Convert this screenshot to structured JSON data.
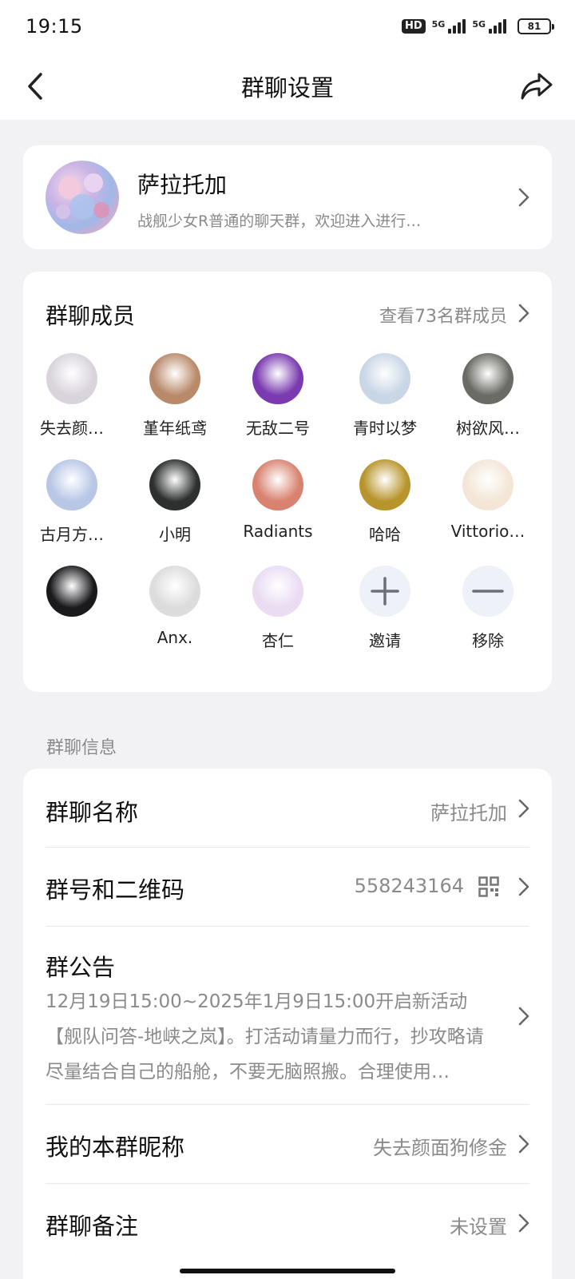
{
  "status_bar": {
    "time": "19:15",
    "hd_label": "HD",
    "network_1": "5G",
    "network_2": "5G",
    "battery": "81"
  },
  "header": {
    "title": "群聊设置",
    "back_icon": "chevron-left-icon",
    "share_icon": "share-arrow-icon"
  },
  "group": {
    "name": "萨拉托加",
    "description": "战舰少女R普通的聊天群，欢迎进入进行…"
  },
  "members": {
    "title": "群聊成员",
    "view_all": "查看73名群成员",
    "list": [
      {
        "name": "失去颜…",
        "color": "#d9d4dc"
      },
      {
        "name": "堇年纸鸢",
        "color": "#b98a6a"
      },
      {
        "name": "无敌二号",
        "color": "#7a3bb0"
      },
      {
        "name": "青时以梦",
        "color": "#c9d6e6"
      },
      {
        "name": "树欲风…",
        "color": "#6b6b66"
      },
      {
        "name": "古月方…",
        "color": "#b8c7e6"
      },
      {
        "name": "小明",
        "color": "#2e2f2f"
      },
      {
        "name": "Radiants",
        "color": "#d9826f"
      },
      {
        "name": "哈哈",
        "color": "#b8952c"
      },
      {
        "name": "Vittorio…",
        "color": "#f3e6d6"
      },
      {
        "name": "",
        "color": "#1a1a1d"
      },
      {
        "name": "Anx.",
        "color": "#dcdcdc"
      },
      {
        "name": "杏仁",
        "color": "#e9dcf3"
      }
    ],
    "invite_label": "邀请",
    "remove_label": "移除"
  },
  "info": {
    "section_title": "群聊信息",
    "group_name_label": "群聊名称",
    "group_name_value": "萨拉托加",
    "group_id_label": "群号和二维码",
    "group_id_value": "558243164",
    "notice_label": "群公告",
    "notice_text": "12月19日15:00~2025年1月9日15:00开启新活动【舰队问答-地峡之岚】。打活动请量力而行，抄攻略请尽量结合自己的船舱，不要无脑照搬。合理使用…",
    "nickname_label": "我的本群昵称",
    "nickname_value": "失去颜面狗修金",
    "remark_label": "群聊备注",
    "remark_value": "未设置"
  }
}
